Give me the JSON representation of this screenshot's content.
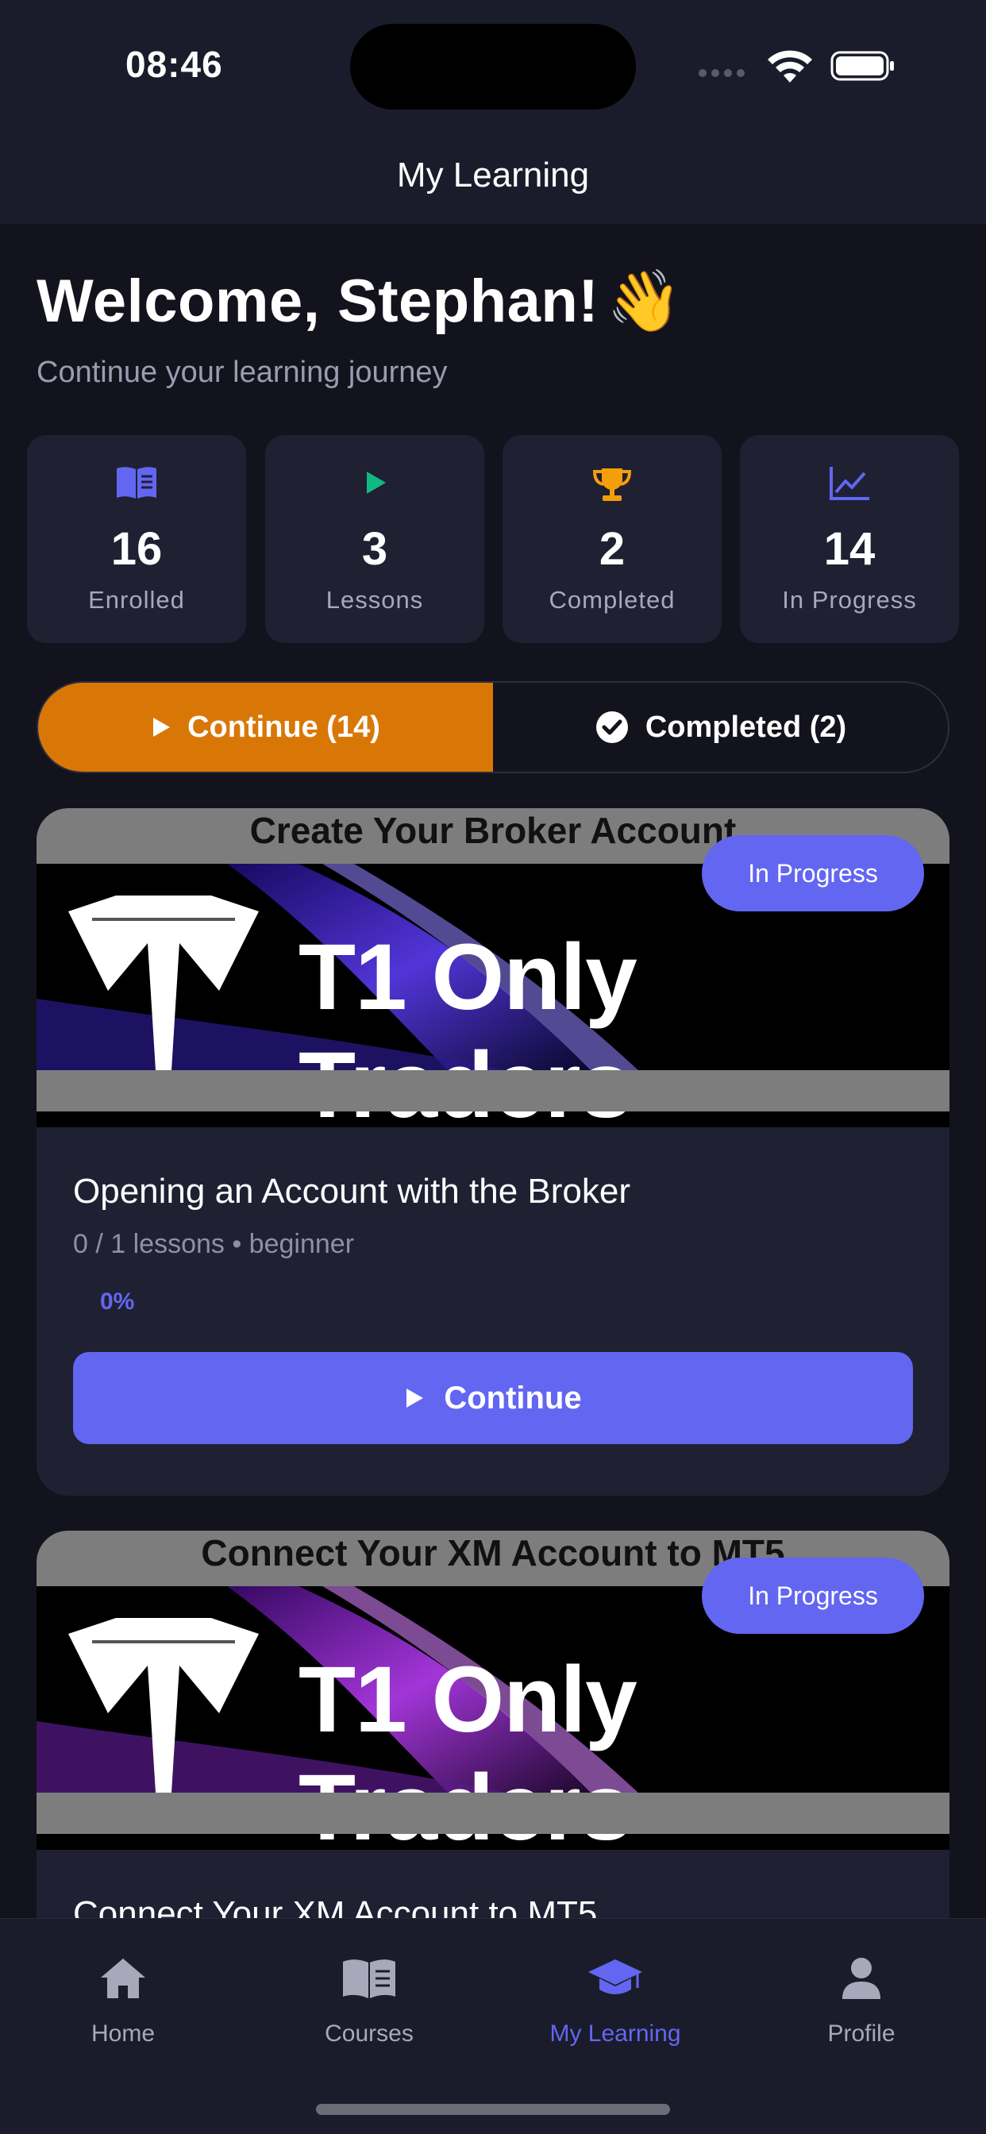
{
  "status_bar": {
    "time": "08:46"
  },
  "header": {
    "title": "My Learning"
  },
  "welcome": {
    "title": "Welcome, Stephan!",
    "emoji": "👋",
    "subtitle": "Continue your learning journey"
  },
  "stats": [
    {
      "icon": "book-icon",
      "value": "16",
      "label": "Enrolled",
      "color": "#6366f1"
    },
    {
      "icon": "play-icon",
      "value": "3",
      "label": "Lessons",
      "color": "#10b981"
    },
    {
      "icon": "trophy-icon",
      "value": "2",
      "label": "Completed",
      "color": "#f59e0b"
    },
    {
      "icon": "trending-chart-icon",
      "value": "14",
      "label": "In Progress",
      "color": "#6366f1"
    }
  ],
  "tabs": [
    {
      "label": "Continue (14)",
      "icon": "play-icon",
      "active": true
    },
    {
      "label": "Completed (2)",
      "icon": "check-circle-icon",
      "active": false
    }
  ],
  "courses": [
    {
      "banner_title": "Create Your Broker Account",
      "brand": "T1 Only Traders",
      "badge": "In Progress",
      "title": "Opening an Account with the Broker",
      "meta": "0 / 1 lessons • beginner",
      "progress": "0%",
      "button": "Continue"
    },
    {
      "banner_title": "Connect Your XM Account to MT5",
      "brand": "T1 Only Traders",
      "badge": "In Progress",
      "title": "Connect Your XM Account to MT5"
    }
  ],
  "tabbar": [
    {
      "label": "Home",
      "icon": "home-icon",
      "active": false
    },
    {
      "label": "Courses",
      "icon": "book-open-icon",
      "active": false
    },
    {
      "label": "My Learning",
      "icon": "graduation-cap-icon",
      "active": true
    },
    {
      "label": "Profile",
      "icon": "person-icon",
      "active": false
    }
  ],
  "colors": {
    "accent": "#6366f1",
    "orange": "#d97706",
    "background": "#12131d",
    "card": "#1f2032"
  }
}
